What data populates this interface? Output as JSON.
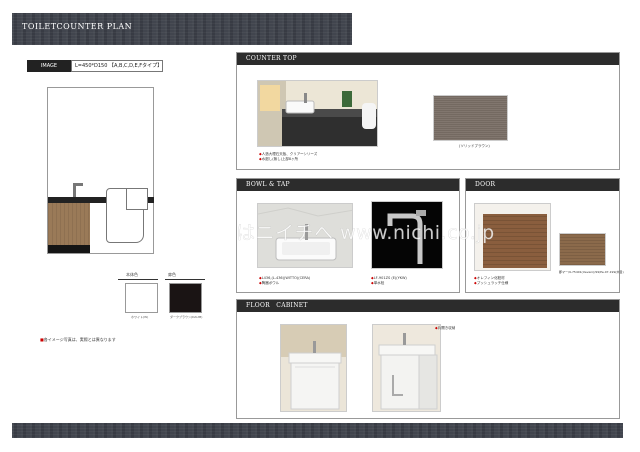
{
  "header": {
    "title": "TOILETCOUNTER   PLAN"
  },
  "image_block": {
    "label": "IMAGE",
    "spec": "L=450*D150 【A,B,C,D,E,Fタイプ】"
  },
  "swatches": [
    {
      "label": "本体色",
      "caption": "ホワイト(W)",
      "color": "#ffffff"
    },
    {
      "label": "扉色",
      "caption": "ダークブラウン(DAUM)",
      "color": "#1a1414"
    }
  ],
  "note": {
    "mark": "■",
    "text": "各イメージ写真は、実際とは異なります"
  },
  "sections": {
    "counter_top": {
      "title": "COUNTER TOP",
      "captions": [
        "人造大理石天板、クリアーシリーズ",
        "水廻し(無し)上部8ヶ所"
      ],
      "material_caption": "(ソリッドブラウン)"
    },
    "bowl_tap": {
      "title": "BOWL & TAP",
      "bowl_captions": [
        "L436,(L-436)(WITTO)(CERA)",
        "陶器ボウル"
      ],
      "tap_captions": [
        "LF-901ZS (E)(YKW)",
        "単水栓"
      ]
    },
    "door": {
      "title": "DOOR",
      "captions": [
        "オレフィン化粧材",
        "プッシュラッチ仕様"
      ],
      "sample_caption": "郡マー/9-75401(Ueveni)/99/Pe-07-199(木目)"
    },
    "floor_cabinet": {
      "title": "FLOOR　CABINET",
      "captions": [
        "片開き収納"
      ]
    }
  },
  "watermark": "はニイチへ www.nichi.co.jp"
}
